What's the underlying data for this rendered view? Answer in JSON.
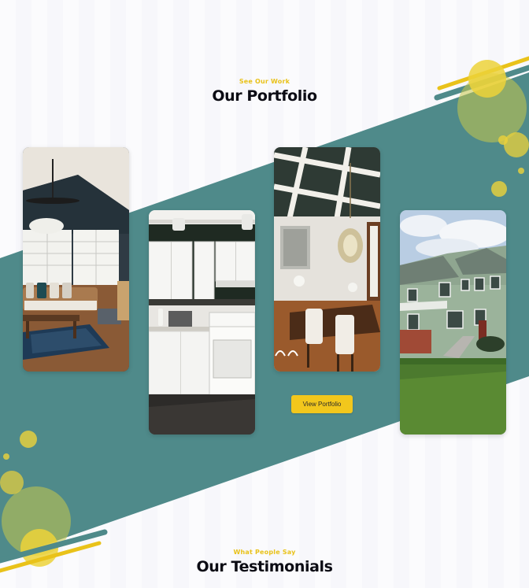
{
  "portfolio": {
    "eyebrow": "See Our Work",
    "title": "Our Portfolio",
    "button_label": "View Portfolio",
    "images": [
      {
        "subject": "living room with vaulted ceiling and ceiling fan"
      },
      {
        "subject": "white kitchen with stove"
      },
      {
        "subject": "dining room with coffered ceiling and chandelier"
      },
      {
        "subject": "green two-story house exterior with lawn"
      }
    ]
  },
  "testimonials": {
    "eyebrow": "What People Say",
    "title": "Our Testimonials"
  },
  "colors": {
    "band": "#4f8a8a",
    "accent": "#f2c71c",
    "heading": "#0c0c14",
    "background": "#f7f7fb"
  }
}
